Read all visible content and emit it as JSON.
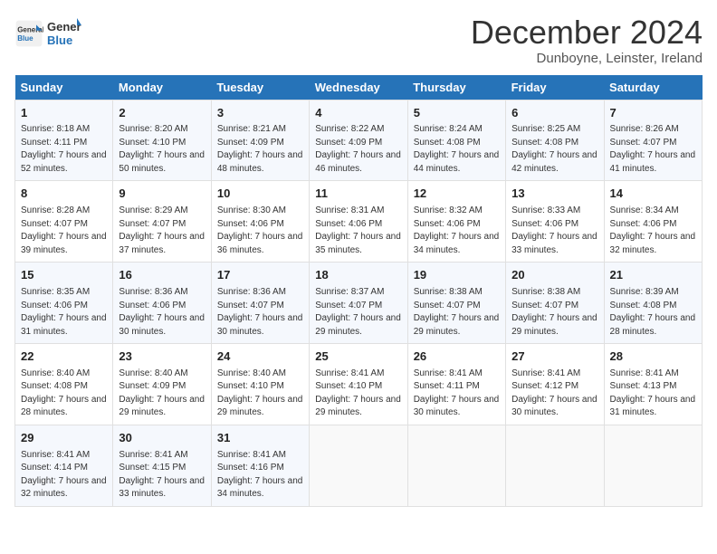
{
  "header": {
    "logo_line1": "General",
    "logo_line2": "Blue",
    "month_title": "December 2024",
    "location": "Dunboyne, Leinster, Ireland"
  },
  "days_of_week": [
    "Sunday",
    "Monday",
    "Tuesday",
    "Wednesday",
    "Thursday",
    "Friday",
    "Saturday"
  ],
  "weeks": [
    [
      {
        "day": 1,
        "sunrise": "8:18 AM",
        "sunset": "4:11 PM",
        "daylight": "7 hours and 52 minutes."
      },
      {
        "day": 2,
        "sunrise": "8:20 AM",
        "sunset": "4:10 PM",
        "daylight": "7 hours and 50 minutes."
      },
      {
        "day": 3,
        "sunrise": "8:21 AM",
        "sunset": "4:09 PM",
        "daylight": "7 hours and 48 minutes."
      },
      {
        "day": 4,
        "sunrise": "8:22 AM",
        "sunset": "4:09 PM",
        "daylight": "7 hours and 46 minutes."
      },
      {
        "day": 5,
        "sunrise": "8:24 AM",
        "sunset": "4:08 PM",
        "daylight": "7 hours and 44 minutes."
      },
      {
        "day": 6,
        "sunrise": "8:25 AM",
        "sunset": "4:08 PM",
        "daylight": "7 hours and 42 minutes."
      },
      {
        "day": 7,
        "sunrise": "8:26 AM",
        "sunset": "4:07 PM",
        "daylight": "7 hours and 41 minutes."
      }
    ],
    [
      {
        "day": 8,
        "sunrise": "8:28 AM",
        "sunset": "4:07 PM",
        "daylight": "7 hours and 39 minutes."
      },
      {
        "day": 9,
        "sunrise": "8:29 AM",
        "sunset": "4:07 PM",
        "daylight": "7 hours and 37 minutes."
      },
      {
        "day": 10,
        "sunrise": "8:30 AM",
        "sunset": "4:06 PM",
        "daylight": "7 hours and 36 minutes."
      },
      {
        "day": 11,
        "sunrise": "8:31 AM",
        "sunset": "4:06 PM",
        "daylight": "7 hours and 35 minutes."
      },
      {
        "day": 12,
        "sunrise": "8:32 AM",
        "sunset": "4:06 PM",
        "daylight": "7 hours and 34 minutes."
      },
      {
        "day": 13,
        "sunrise": "8:33 AM",
        "sunset": "4:06 PM",
        "daylight": "7 hours and 33 minutes."
      },
      {
        "day": 14,
        "sunrise": "8:34 AM",
        "sunset": "4:06 PM",
        "daylight": "7 hours and 32 minutes."
      }
    ],
    [
      {
        "day": 15,
        "sunrise": "8:35 AM",
        "sunset": "4:06 PM",
        "daylight": "7 hours and 31 minutes."
      },
      {
        "day": 16,
        "sunrise": "8:36 AM",
        "sunset": "4:06 PM",
        "daylight": "7 hours and 30 minutes."
      },
      {
        "day": 17,
        "sunrise": "8:36 AM",
        "sunset": "4:07 PM",
        "daylight": "7 hours and 30 minutes."
      },
      {
        "day": 18,
        "sunrise": "8:37 AM",
        "sunset": "4:07 PM",
        "daylight": "7 hours and 29 minutes."
      },
      {
        "day": 19,
        "sunrise": "8:38 AM",
        "sunset": "4:07 PM",
        "daylight": "7 hours and 29 minutes."
      },
      {
        "day": 20,
        "sunrise": "8:38 AM",
        "sunset": "4:07 PM",
        "daylight": "7 hours and 29 minutes."
      },
      {
        "day": 21,
        "sunrise": "8:39 AM",
        "sunset": "4:08 PM",
        "daylight": "7 hours and 28 minutes."
      }
    ],
    [
      {
        "day": 22,
        "sunrise": "8:40 AM",
        "sunset": "4:08 PM",
        "daylight": "7 hours and 28 minutes."
      },
      {
        "day": 23,
        "sunrise": "8:40 AM",
        "sunset": "4:09 PM",
        "daylight": "7 hours and 29 minutes."
      },
      {
        "day": 24,
        "sunrise": "8:40 AM",
        "sunset": "4:10 PM",
        "daylight": "7 hours and 29 minutes."
      },
      {
        "day": 25,
        "sunrise": "8:41 AM",
        "sunset": "4:10 PM",
        "daylight": "7 hours and 29 minutes."
      },
      {
        "day": 26,
        "sunrise": "8:41 AM",
        "sunset": "4:11 PM",
        "daylight": "7 hours and 30 minutes."
      },
      {
        "day": 27,
        "sunrise": "8:41 AM",
        "sunset": "4:12 PM",
        "daylight": "7 hours and 30 minutes."
      },
      {
        "day": 28,
        "sunrise": "8:41 AM",
        "sunset": "4:13 PM",
        "daylight": "7 hours and 31 minutes."
      }
    ],
    [
      {
        "day": 29,
        "sunrise": "8:41 AM",
        "sunset": "4:14 PM",
        "daylight": "7 hours and 32 minutes."
      },
      {
        "day": 30,
        "sunrise": "8:41 AM",
        "sunset": "4:15 PM",
        "daylight": "7 hours and 33 minutes."
      },
      {
        "day": 31,
        "sunrise": "8:41 AM",
        "sunset": "4:16 PM",
        "daylight": "7 hours and 34 minutes."
      },
      null,
      null,
      null,
      null
    ]
  ]
}
